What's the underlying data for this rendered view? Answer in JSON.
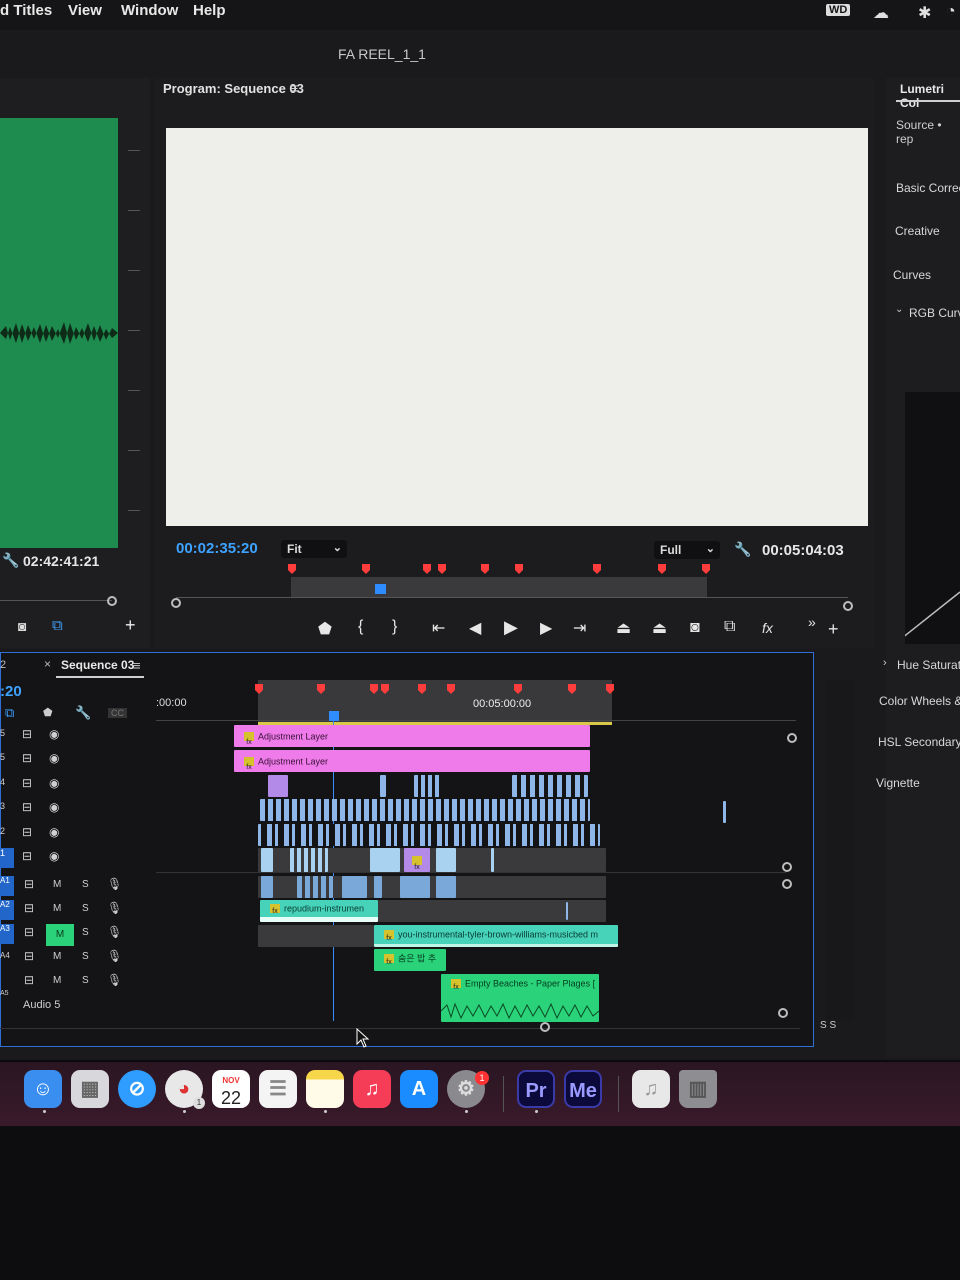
{
  "menubar": {
    "items": [
      "d Titles",
      "View",
      "Window",
      "Help"
    ],
    "tray_wd": "WD"
  },
  "app": {
    "title": "FA REEL_1_1"
  },
  "source": {
    "timecode": "02:42:41:21"
  },
  "program": {
    "header": "Program: Sequence 03",
    "current_time": "00:02:35:20",
    "fit": "Fit",
    "resolution": "Full",
    "duration": "00:05:04:03",
    "fx_label": "fx"
  },
  "lumetri": {
    "title": "Lumetri Col",
    "source": "Source • rep",
    "sections": [
      "Basic Correc",
      "Creative",
      "Curves",
      "RGB Curv",
      "Hue Saturati",
      "Color Wheels &",
      "HSL Secondary",
      "Vignette"
    ]
  },
  "timeline": {
    "tab_number": "2",
    "tab_close": "×",
    "tab_label": "Sequence 03",
    "timecode_partial": ":20",
    "ruler_start": ":00:00",
    "ruler_mid": "00:05:00:00",
    "video_tracks": [
      "5",
      "5",
      "4",
      "3",
      "2",
      "1"
    ],
    "audio_tracks": [
      "A1",
      "A2",
      "A3",
      "A4",
      "A5"
    ],
    "audio5_label": "Audio 5",
    "mute": "M",
    "solo": "S",
    "clips": {
      "adj1": "Adjustment Layer",
      "adj2": "Adjustment Layer",
      "repudium": "repudium-instrumen",
      "you": "you-instrumental-tyler-brown-williams-musicbed m",
      "korean": "숨은 밥 추",
      "empty": "Empty Beaches - Paper Plages [",
      "fx": "fx"
    },
    "meter_label": "S S"
  },
  "dock": {
    "calendar_month": "NOV",
    "calendar_day": "22",
    "settings_badge": "1",
    "chrome_badge": "1",
    "premiere": "Pr",
    "media_encoder": "Me"
  }
}
